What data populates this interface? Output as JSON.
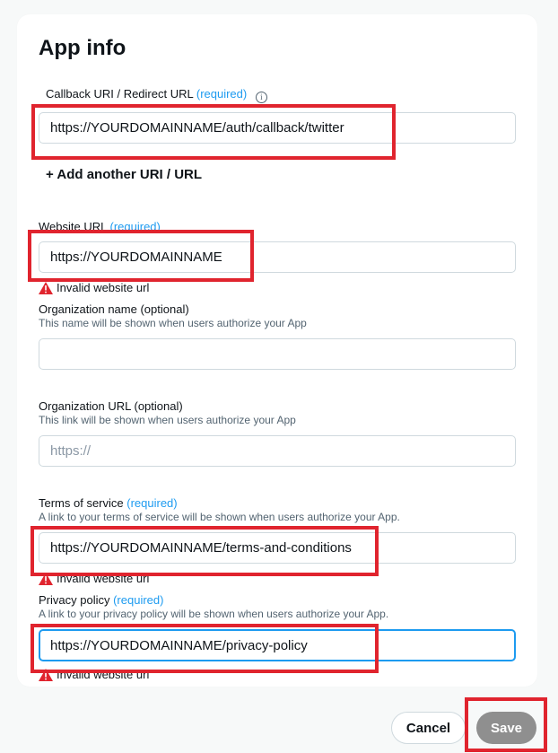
{
  "title": "App info",
  "callback": {
    "label": "Callback URI / Redirect URL",
    "required": "(required)",
    "value": "https://YOURDOMAINNAME/auth/callback/twitter",
    "add_another": "+ Add another URI / URL"
  },
  "website": {
    "label": "Website URL",
    "required": "(required)",
    "value": "https://YOURDOMAINNAME",
    "error": "Invalid website url"
  },
  "org_name": {
    "label": "Organization name",
    "optional": "(optional)",
    "help": "This name will be shown when users authorize your App",
    "value": ""
  },
  "org_url": {
    "label": "Organization URL",
    "optional": "(optional)",
    "help": "This link will be shown when users authorize your App",
    "placeholder": "https://"
  },
  "terms": {
    "label": "Terms of service",
    "required": "(required)",
    "help": "A link to your terms of service will be shown when users authorize your App.",
    "value": "https://YOURDOMAINNAME/terms-and-conditions",
    "error": "Invalid website url"
  },
  "privacy": {
    "label": "Privacy policy",
    "required": "(required)",
    "help": "A link to your privacy policy will be shown when users authorize your App.",
    "value": "https://YOURDOMAINNAME/privacy-policy",
    "error": "Invalid website url"
  },
  "buttons": {
    "cancel": "Cancel",
    "save": "Save"
  },
  "colors": {
    "accent": "#1d9bf0",
    "error": "#e0242e",
    "save_disabled": "#8f8f8f"
  },
  "icons": [
    "info-icon",
    "warning-icon"
  ]
}
